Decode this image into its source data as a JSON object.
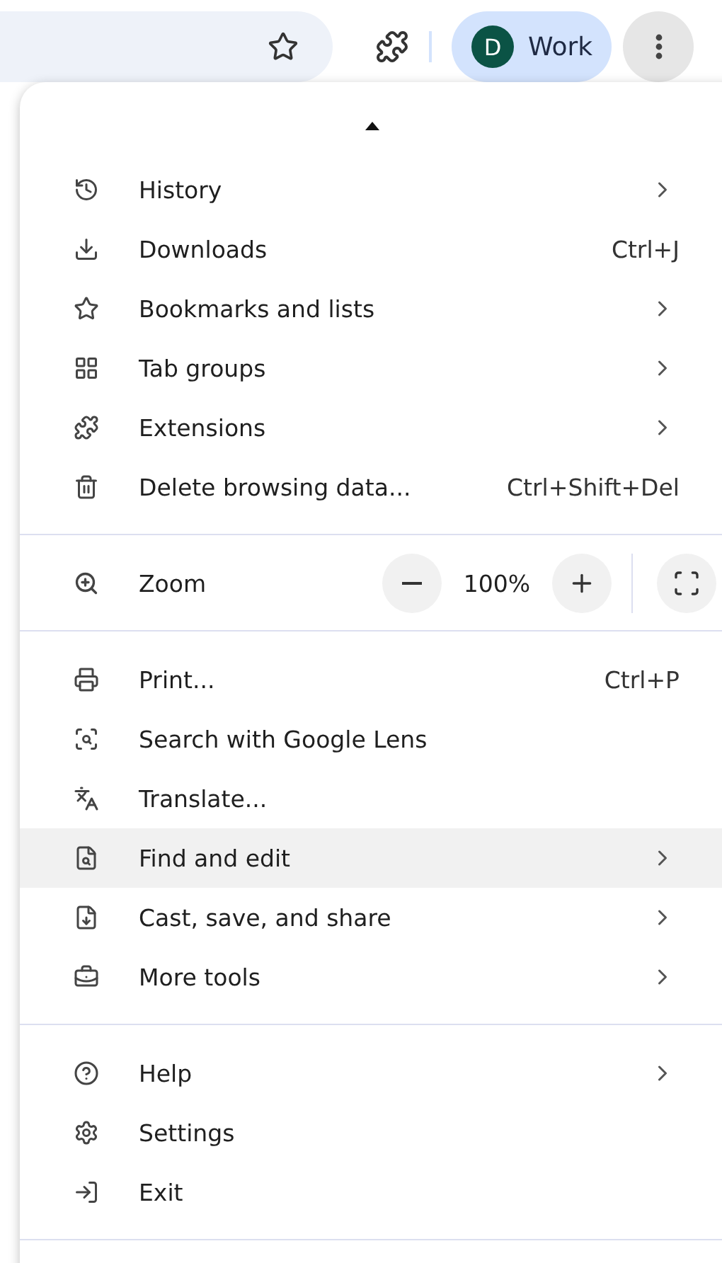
{
  "toolbar": {
    "profile": {
      "initial": "D",
      "name": "Work"
    }
  },
  "menu": {
    "sections": [
      {
        "items": [
          {
            "kind": "item",
            "label": "History",
            "submenu": true,
            "selected": false
          },
          {
            "kind": "item",
            "label": "Downloads",
            "shortcut": "Ctrl+J",
            "submenu": false,
            "selected": false
          },
          {
            "kind": "item",
            "label": "Bookmarks and lists",
            "submenu": true,
            "selected": false
          },
          {
            "kind": "item",
            "label": "Tab groups",
            "submenu": true,
            "selected": false
          },
          {
            "kind": "item",
            "label": "Extensions",
            "submenu": true,
            "selected": false
          },
          {
            "kind": "item",
            "label": "Delete browsing data...",
            "shortcut": "Ctrl+Shift+Del",
            "submenu": false,
            "selected": false
          }
        ]
      },
      {
        "items": [
          {
            "kind": "zoom",
            "label": "Zoom",
            "value": "100%"
          }
        ]
      },
      {
        "items": [
          {
            "kind": "item",
            "label": "Print...",
            "shortcut": "Ctrl+P",
            "submenu": false,
            "selected": false
          },
          {
            "kind": "item",
            "label": "Search with Google Lens",
            "submenu": false,
            "selected": false
          },
          {
            "kind": "item",
            "label": "Translate...",
            "submenu": false,
            "selected": false
          },
          {
            "kind": "item",
            "label": "Find and edit",
            "submenu": true,
            "selected": true
          },
          {
            "kind": "item",
            "label": "Cast, save, and share",
            "submenu": true,
            "selected": false
          },
          {
            "kind": "item",
            "label": "More tools",
            "submenu": true,
            "selected": false
          }
        ]
      },
      {
        "items": [
          {
            "kind": "item",
            "label": "Help",
            "submenu": true,
            "selected": false
          },
          {
            "kind": "item",
            "label": "Settings",
            "submenu": false,
            "selected": false
          },
          {
            "kind": "item",
            "label": "Exit",
            "submenu": false,
            "selected": false
          }
        ]
      }
    ]
  }
}
